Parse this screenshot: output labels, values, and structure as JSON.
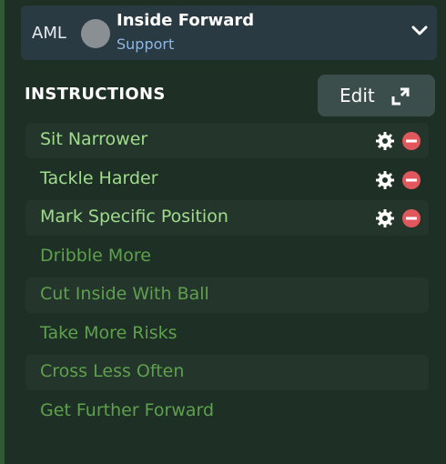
{
  "role": {
    "position": "AML",
    "name": "Inside Forward",
    "duty": "Support"
  },
  "section": {
    "title": "INSTRUCTIONS",
    "edit_label": "Edit"
  },
  "colors": {
    "active_text": "#9fdc8c",
    "inactive_text": "#5ea04d",
    "remove_red": "#e0585c"
  },
  "instructions": [
    {
      "label": "Sit Narrower",
      "selected": true
    },
    {
      "label": "Tackle Harder",
      "selected": true
    },
    {
      "label": "Mark Specific Position",
      "selected": true
    },
    {
      "label": "Dribble More",
      "selected": false
    },
    {
      "label": "Cut Inside With Ball",
      "selected": false
    },
    {
      "label": "Take More Risks",
      "selected": false
    },
    {
      "label": "Cross Less Often",
      "selected": false
    },
    {
      "label": "Get Further Forward",
      "selected": false
    }
  ]
}
